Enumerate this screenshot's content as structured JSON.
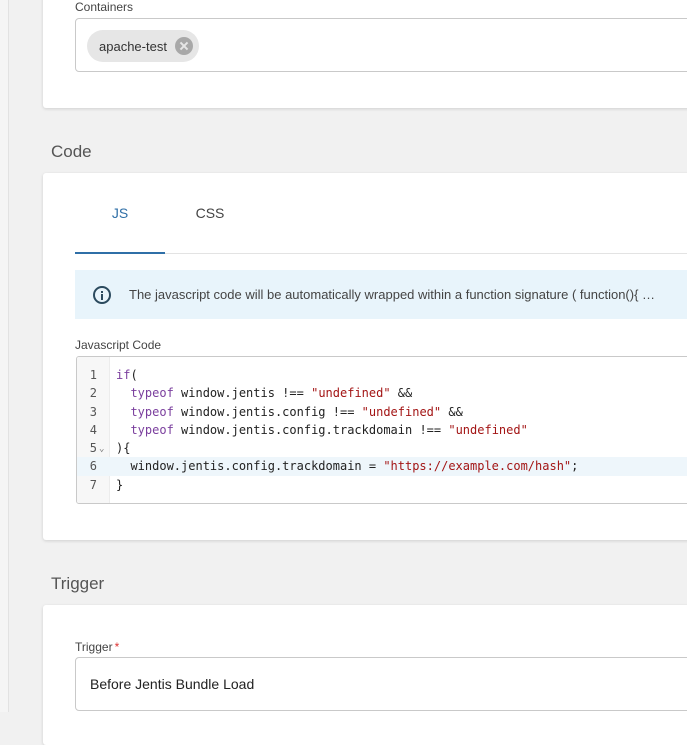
{
  "containers": {
    "label": "Containers",
    "chips": [
      {
        "label": "apache-test"
      }
    ]
  },
  "code_section": {
    "title": "Code",
    "tabs": [
      {
        "label": "JS",
        "active": true
      },
      {
        "label": "CSS",
        "active": false
      }
    ],
    "info": "The javascript code will be automatically wrapped within a function signature ( function(){ …",
    "editor_label": "Javascript Code",
    "lines": [
      {
        "n": "1",
        "text": "if("
      },
      {
        "n": "2",
        "text": "  typeof window.jentis !== \"undefined\" &&"
      },
      {
        "n": "3",
        "text": "  typeof window.jentis.config !== \"undefined\" &&"
      },
      {
        "n": "4",
        "text": "  typeof window.jentis.config.trackdomain !== \"undefined\""
      },
      {
        "n": "5",
        "text": "){"
      },
      {
        "n": "6",
        "text": "  window.jentis.config.trackdomain = \"https://example.com/hash\";"
      },
      {
        "n": "7",
        "text": "}"
      }
    ],
    "active_line": 6,
    "fold_line": 5
  },
  "trigger_section": {
    "title": "Trigger",
    "field_label": "Trigger",
    "required_mark": "*",
    "value": "Before Jentis Bundle Load"
  },
  "colors": {
    "accent": "#2f6fa7",
    "info_bg": "#e8f4fb",
    "keyword": "#7a3e9d",
    "string": "#a31515"
  }
}
